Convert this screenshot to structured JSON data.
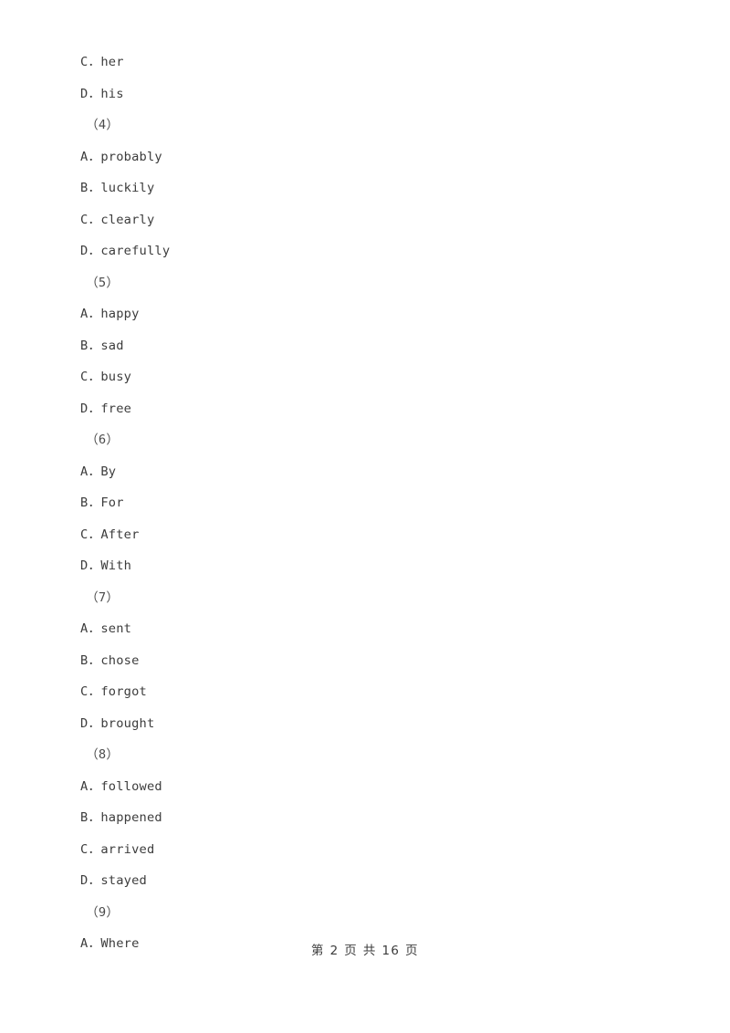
{
  "document": {
    "separator": "．",
    "lines": [
      {
        "kind": "option",
        "letter": "C",
        "text": "her",
        "full": "C．her"
      },
      {
        "kind": "option",
        "letter": "D",
        "text": "his",
        "full": "D．his"
      },
      {
        "kind": "group",
        "label": "（4）"
      },
      {
        "kind": "option",
        "letter": "A",
        "text": "probably",
        "full": "A．probably"
      },
      {
        "kind": "option",
        "letter": "B",
        "text": "luckily",
        "full": "B．luckily"
      },
      {
        "kind": "option",
        "letter": "C",
        "text": "clearly",
        "full": "C．clearly"
      },
      {
        "kind": "option",
        "letter": "D",
        "text": "carefully",
        "full": "D．carefully"
      },
      {
        "kind": "group",
        "label": "（5）"
      },
      {
        "kind": "option",
        "letter": "A",
        "text": "happy",
        "full": "A．happy"
      },
      {
        "kind": "option",
        "letter": "B",
        "text": "sad",
        "full": "B．sad"
      },
      {
        "kind": "option",
        "letter": "C",
        "text": "busy",
        "full": "C．busy"
      },
      {
        "kind": "option",
        "letter": "D",
        "text": "free",
        "full": "D．free"
      },
      {
        "kind": "group",
        "label": "（6）"
      },
      {
        "kind": "option",
        "letter": "A",
        "text": "By",
        "full": "A．By"
      },
      {
        "kind": "option",
        "letter": "B",
        "text": "For",
        "full": "B．For"
      },
      {
        "kind": "option",
        "letter": "C",
        "text": "After",
        "full": "C．After"
      },
      {
        "kind": "option",
        "letter": "D",
        "text": "With",
        "full": "D．With"
      },
      {
        "kind": "group",
        "label": "（7）"
      },
      {
        "kind": "option",
        "letter": "A",
        "text": "sent",
        "full": "A．sent"
      },
      {
        "kind": "option",
        "letter": "B",
        "text": "chose",
        "full": "B．chose"
      },
      {
        "kind": "option",
        "letter": "C",
        "text": "forgot",
        "full": "C．forgot"
      },
      {
        "kind": "option",
        "letter": "D",
        "text": "brought",
        "full": "D．brought"
      },
      {
        "kind": "group",
        "label": "（8）"
      },
      {
        "kind": "option",
        "letter": "A",
        "text": "followed",
        "full": "A．followed"
      },
      {
        "kind": "option",
        "letter": "B",
        "text": "happened",
        "full": "B．happened"
      },
      {
        "kind": "option",
        "letter": "C",
        "text": "arrived",
        "full": "C．arrived"
      },
      {
        "kind": "option",
        "letter": "D",
        "text": "stayed",
        "full": "D．stayed"
      },
      {
        "kind": "group",
        "label": "（9）"
      },
      {
        "kind": "option",
        "letter": "A",
        "text": "Where",
        "full": "A．Where"
      }
    ]
  },
  "footer": {
    "text": "第 2 页 共 16 页",
    "current_page": "2",
    "total_pages": "16"
  },
  "colors": {
    "page_background": "#ffffff",
    "text": "#3c3c3c"
  }
}
